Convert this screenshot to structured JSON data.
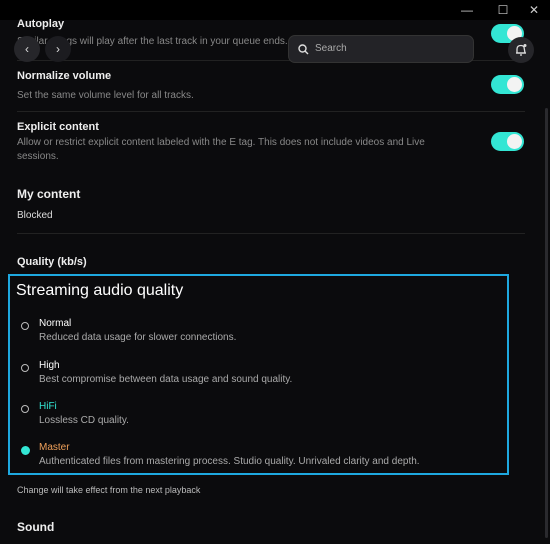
{
  "window": {
    "minimize": "—",
    "maximize": "☐",
    "close": "✕"
  },
  "settings": [
    {
      "title": "Autoplay",
      "desc": "Similar songs will play after the last track in your queue ends.",
      "on": true
    },
    {
      "title": "Normalize volume",
      "desc": "Set the same volume level for all tracks.",
      "on": true
    },
    {
      "title": "Explicit content",
      "desc": "Allow or restrict explicit content labeled with the E tag. This does not include videos and Live sessions.",
      "on": true
    }
  ],
  "my_content": {
    "heading": "My content",
    "blocked": "Blocked"
  },
  "quality": {
    "heading": "Quality (kb/s)",
    "title": "Streaming audio quality",
    "options": [
      {
        "label": "Normal",
        "desc": "Reduced data usage for slower connections.",
        "color": "#ffffff",
        "selected": false
      },
      {
        "label": "High",
        "desc": "Best compromise between data usage and sound quality.",
        "color": "#ffffff",
        "selected": false
      },
      {
        "label": "HiFi",
        "desc": "Lossless CD quality.",
        "color": "#33e6d4",
        "selected": false
      },
      {
        "label": "Master",
        "desc": "Authenticated files from mastering process. Studio quality. Unrivaled clarity and depth.",
        "color": "#f0a15a",
        "selected": true
      }
    ],
    "note": "Change will take effect from the next playback"
  },
  "sound": {
    "heading": "Sound"
  },
  "nav": {
    "back": "‹",
    "forward": "›",
    "search_placeholder": "Search",
    "search_icon": "search-icon",
    "bell_icon": "bell-icon"
  },
  "accent": "#33e6d4",
  "highlight": "#1ea8e0"
}
